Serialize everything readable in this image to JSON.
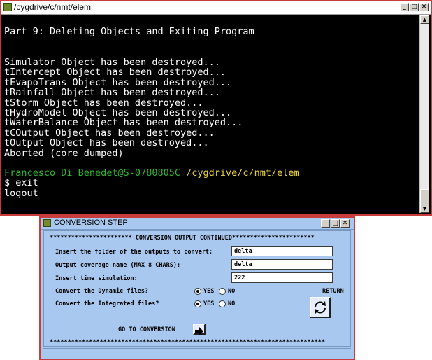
{
  "terminal": {
    "title": "/cygdrive/c/nmt/elem",
    "window_buttons": [
      "_",
      "□",
      "✕"
    ],
    "heading": "Part 9: Deleting Objects and Exiting Program",
    "rule": "----------------------------------------------------",
    "lines": [
      "Simulator Object has been destroyed...",
      "tIntercept Object has been destroyed...",
      "tEvapoTrans Object has been destroyed...",
      "tRainfall Object has been destroyed...",
      "tStorm Object has been destroyed...",
      "tHydroModel Object has been destroyed...",
      "tWaterBalance Object has been destroyed...",
      "tCOutput Object has been destroyed...",
      "tOutput Object has been destroyed...",
      "Aborted (core dumped)"
    ],
    "prompt_user": "Francesco Di Benedet@S-0780805C",
    "prompt_path": "/cygdrive/c/nmt/elem",
    "command": "$ exit",
    "logout": "logout"
  },
  "dialog": {
    "title": "CONVERSION STEP",
    "window_buttons": [
      "_",
      "□",
      "✕"
    ],
    "header": "*********************** CONVERSION OUTPUT CONTINUED***********************",
    "fields": [
      {
        "label": "Insert the folder of the outputs to convert:",
        "value": "delta"
      },
      {
        "label": "Output coverage name (MAX 8 CHARS):",
        "value": "delta"
      },
      {
        "label": "Insert time simulation:",
        "value": "222"
      }
    ],
    "dynamic": {
      "label": "Convert the Dynamic files?",
      "yes": "YES",
      "no": "NO",
      "selected": "YES"
    },
    "integrated": {
      "label": "Convert the Integrated files?",
      "yes": "YES",
      "no": "NO",
      "selected": "YES"
    },
    "return_label": "RETURN",
    "return_icon": "refresh-icon",
    "go_label": "GO TO CONVERSION",
    "go_icon": "arrow-right-icon",
    "footer": "*****************************************************************************"
  },
  "colors": {
    "terminal_bg": "#000000",
    "prompt_user": "#2fb52f",
    "prompt_path": "#e8d23a",
    "dialog_bg": "#a9c8ef",
    "window_border": "#c83c3c"
  }
}
